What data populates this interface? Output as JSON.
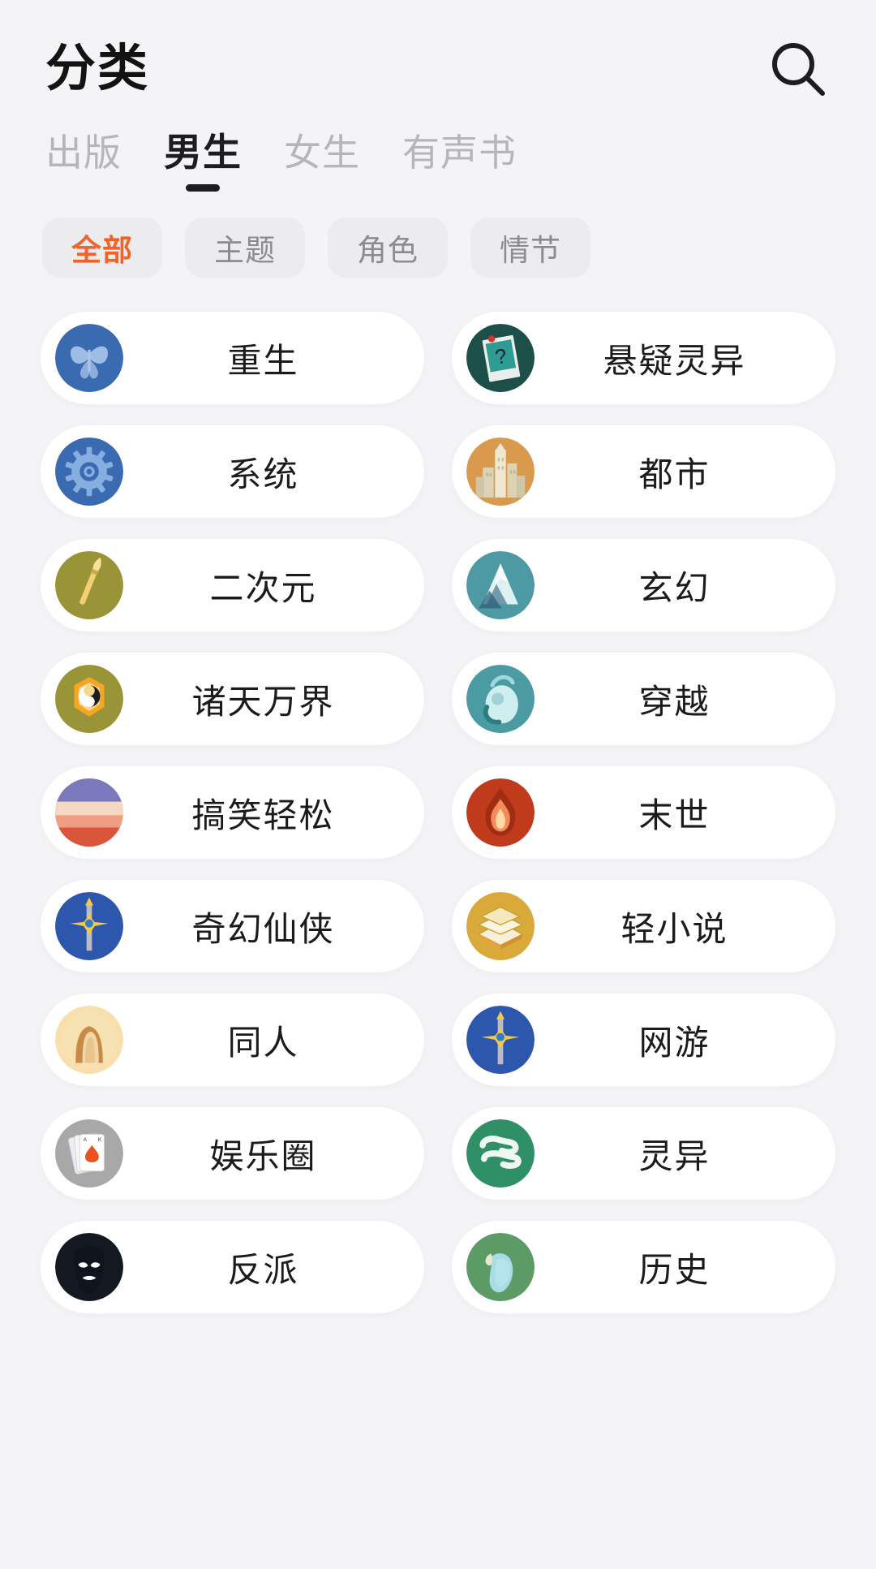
{
  "header": {
    "title": "分类",
    "search_icon": "search-icon"
  },
  "tabs": [
    {
      "label": "出版",
      "active": false
    },
    {
      "label": "男生",
      "active": true
    },
    {
      "label": "女生",
      "active": false
    },
    {
      "label": "有声书",
      "active": false
    }
  ],
  "filter_chips": [
    {
      "label": "全部",
      "active": true
    },
    {
      "label": "主题",
      "active": false
    },
    {
      "label": "角色",
      "active": false
    },
    {
      "label": "情节",
      "active": false
    }
  ],
  "colors": {
    "accent": "#f0632b",
    "page_background": "#f4f4f6",
    "card_background": "#ffffff",
    "chip_background": "#ececee",
    "text_primary": "#1b1b1d",
    "text_muted": "#b6b6ba"
  },
  "categories": [
    {
      "label": "重生",
      "icon": "butterfly-icon",
      "bg": "#3a6ab0",
      "fg": "#a9c6ea"
    },
    {
      "label": "悬疑灵异",
      "icon": "mystery-photo-icon",
      "bg": "#1d4f49",
      "fg": "#2f9b92"
    },
    {
      "label": "系统",
      "icon": "gear-icon",
      "bg": "#3a6ab0",
      "fg": "#86aee0"
    },
    {
      "label": "都市",
      "icon": "city-icon",
      "bg": "#d99a4e",
      "fg": "#efe7cf"
    },
    {
      "label": "二次元",
      "icon": "paintbrush-icon",
      "bg": "#9a9438",
      "fg": "#f2cf72"
    },
    {
      "label": "玄幻",
      "icon": "mountain-icon",
      "bg": "#4e9aa4",
      "fg": "#dff0f2"
    },
    {
      "label": "诸天万界",
      "icon": "yinyang-icon",
      "bg": "#9a9438",
      "fg": "#f5a623"
    },
    {
      "label": "穿越",
      "icon": "portal-icon",
      "bg": "#4b9ba3",
      "fg": "#cfeef0"
    },
    {
      "label": "搞笑轻松",
      "icon": "sunrise-icon",
      "bg": "#f0a08a",
      "fg": "#7b79bd"
    },
    {
      "label": "末世",
      "icon": "flame-icon",
      "bg": "#c03a1c",
      "fg": "#f48a5a"
    },
    {
      "label": "奇幻仙侠",
      "icon": "sword-icon",
      "bg": "#2d57ad",
      "fg": "#f6c944"
    },
    {
      "label": "轻小说",
      "icon": "books-icon",
      "bg": "#d9a93a",
      "fg": "#f8efd8"
    },
    {
      "label": "同人",
      "icon": "portrait-icon",
      "bg": "#f7dfae",
      "fg": "#c98a45"
    },
    {
      "label": "网游",
      "icon": "sword-icon",
      "bg": "#2d57ad",
      "fg": "#f6c944"
    },
    {
      "label": "娱乐圈",
      "icon": "playing-cards-icon",
      "bg": "#a8a8a8",
      "fg": "#ffffff"
    },
    {
      "label": "灵异",
      "icon": "wisp-icon",
      "bg": "#2f9068",
      "fg": "#eef7f1"
    },
    {
      "label": "反派",
      "icon": "masked-villain-icon",
      "bg": "#141820",
      "fg": "#ffffff"
    },
    {
      "label": "历史",
      "icon": "scroll-icon",
      "bg": "#5c9a66",
      "fg": "#a9dce4"
    }
  ]
}
